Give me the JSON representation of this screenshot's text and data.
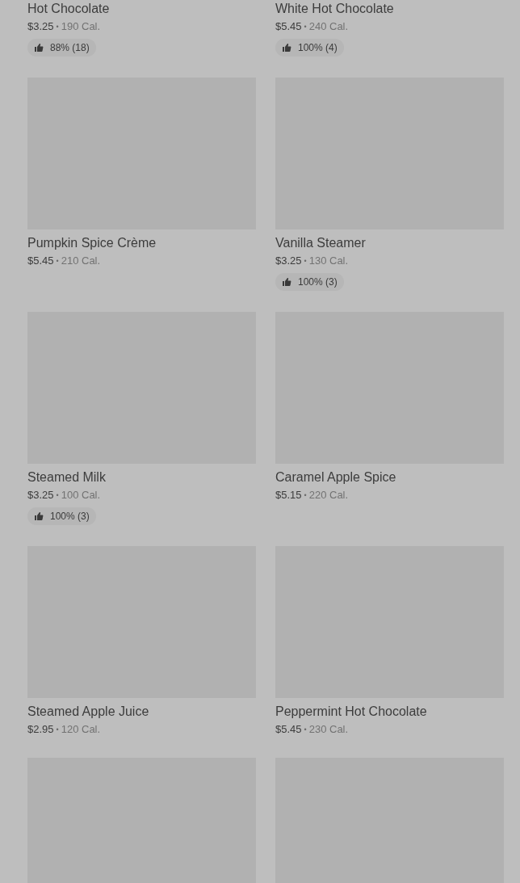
{
  "items": [
    {
      "kind": "text_only",
      "name": "Hot Chocolate",
      "price": "$3.25",
      "separator": "•",
      "calories": "190 Cal.",
      "rating": "88% (18)"
    },
    {
      "kind": "text_only",
      "name": "White Hot Chocolate",
      "price": "$5.45",
      "separator": "•",
      "calories": "240 Cal.",
      "rating": "100% (4)"
    },
    {
      "kind": "full",
      "name": "Pumpkin Spice Crème",
      "price": "$5.45",
      "separator": "•",
      "calories": "210 Cal."
    },
    {
      "kind": "full",
      "name": "Vanilla Steamer",
      "price": "$3.25",
      "separator": "•",
      "calories": "130 Cal.",
      "rating": "100% (3)"
    },
    {
      "kind": "full",
      "name": "Steamed Milk",
      "price": "$3.25",
      "separator": "•",
      "calories": "100 Cal.",
      "rating": "100% (3)"
    },
    {
      "kind": "full",
      "name": "Caramel Apple Spice",
      "price": "$5.15",
      "separator": "•",
      "calories": "220 Cal."
    },
    {
      "kind": "full",
      "name": "Steamed Apple Juice",
      "price": "$2.95",
      "separator": "•",
      "calories": "120 Cal."
    },
    {
      "kind": "full",
      "name": "Peppermint Hot Chocolate",
      "price": "$5.45",
      "separator": "•",
      "calories": "230 Cal."
    },
    {
      "kind": "image_only"
    },
    {
      "kind": "image_only"
    }
  ]
}
